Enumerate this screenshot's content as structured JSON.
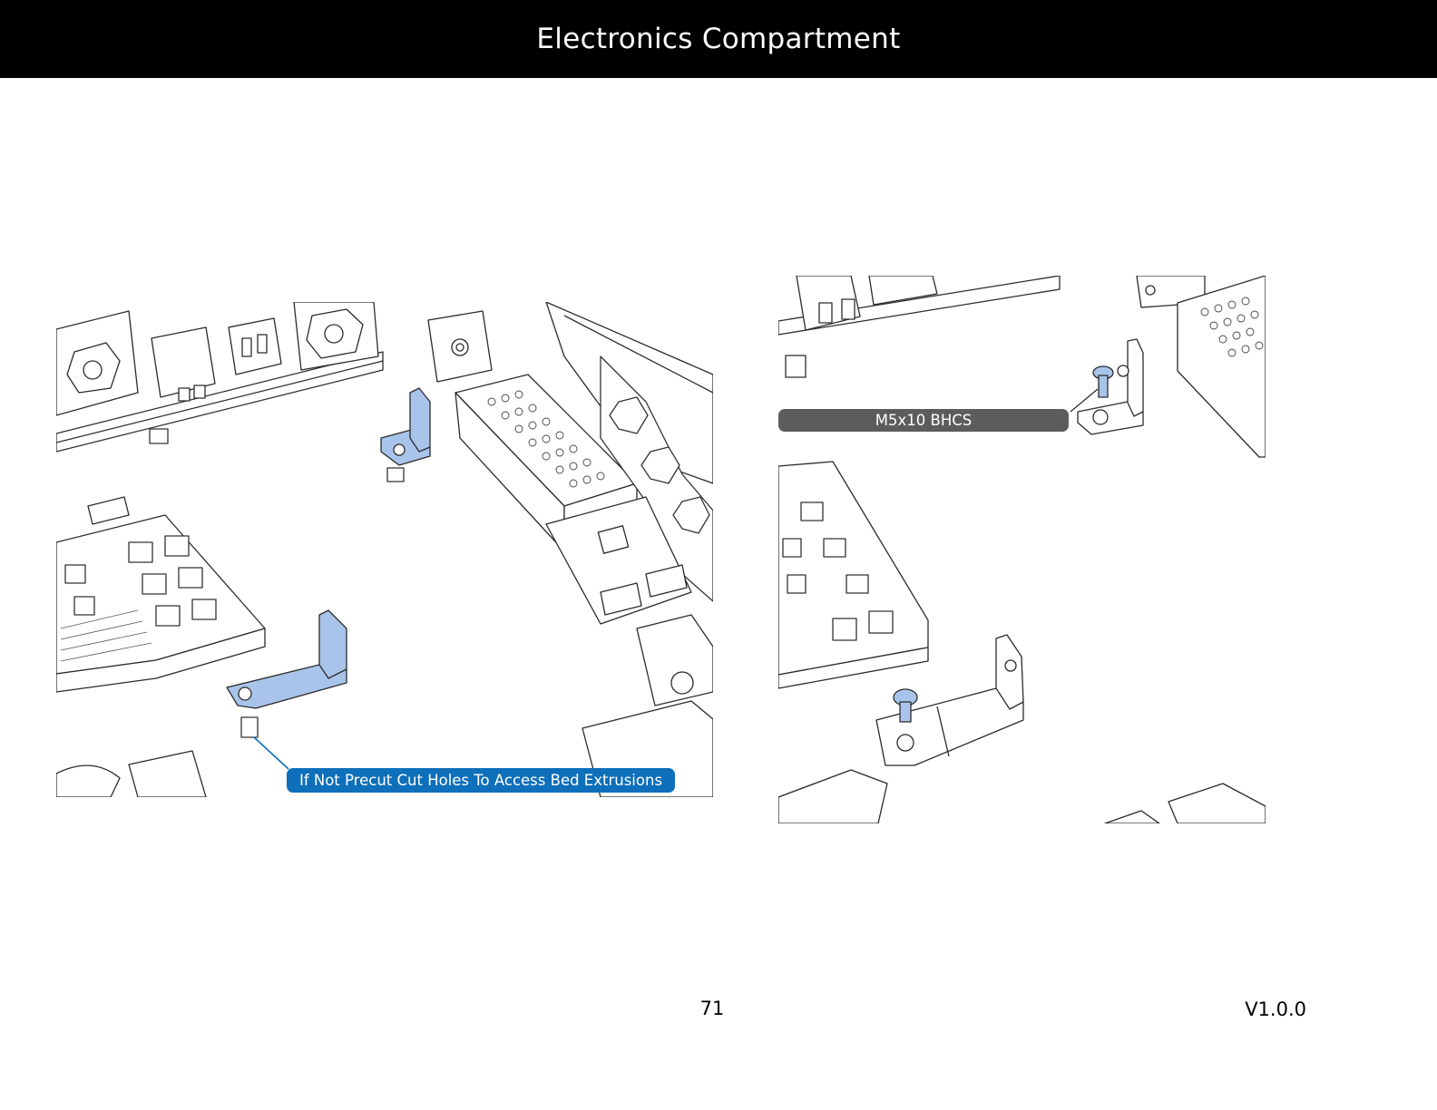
{
  "header": {
    "title": "Electronics Compartment"
  },
  "figures": {
    "left": {
      "callout": "If Not Precut Cut Holes To Access Bed Extrusions",
      "callout_color": "#0e6fba",
      "highlight_color": "#a9c4ea"
    },
    "right": {
      "callout": "M5x10 BHCS",
      "callout_color": "#5c5c5c",
      "highlight_color": "#a9c4ea"
    }
  },
  "footer": {
    "page_number": "71",
    "version": "V1.0.0"
  }
}
